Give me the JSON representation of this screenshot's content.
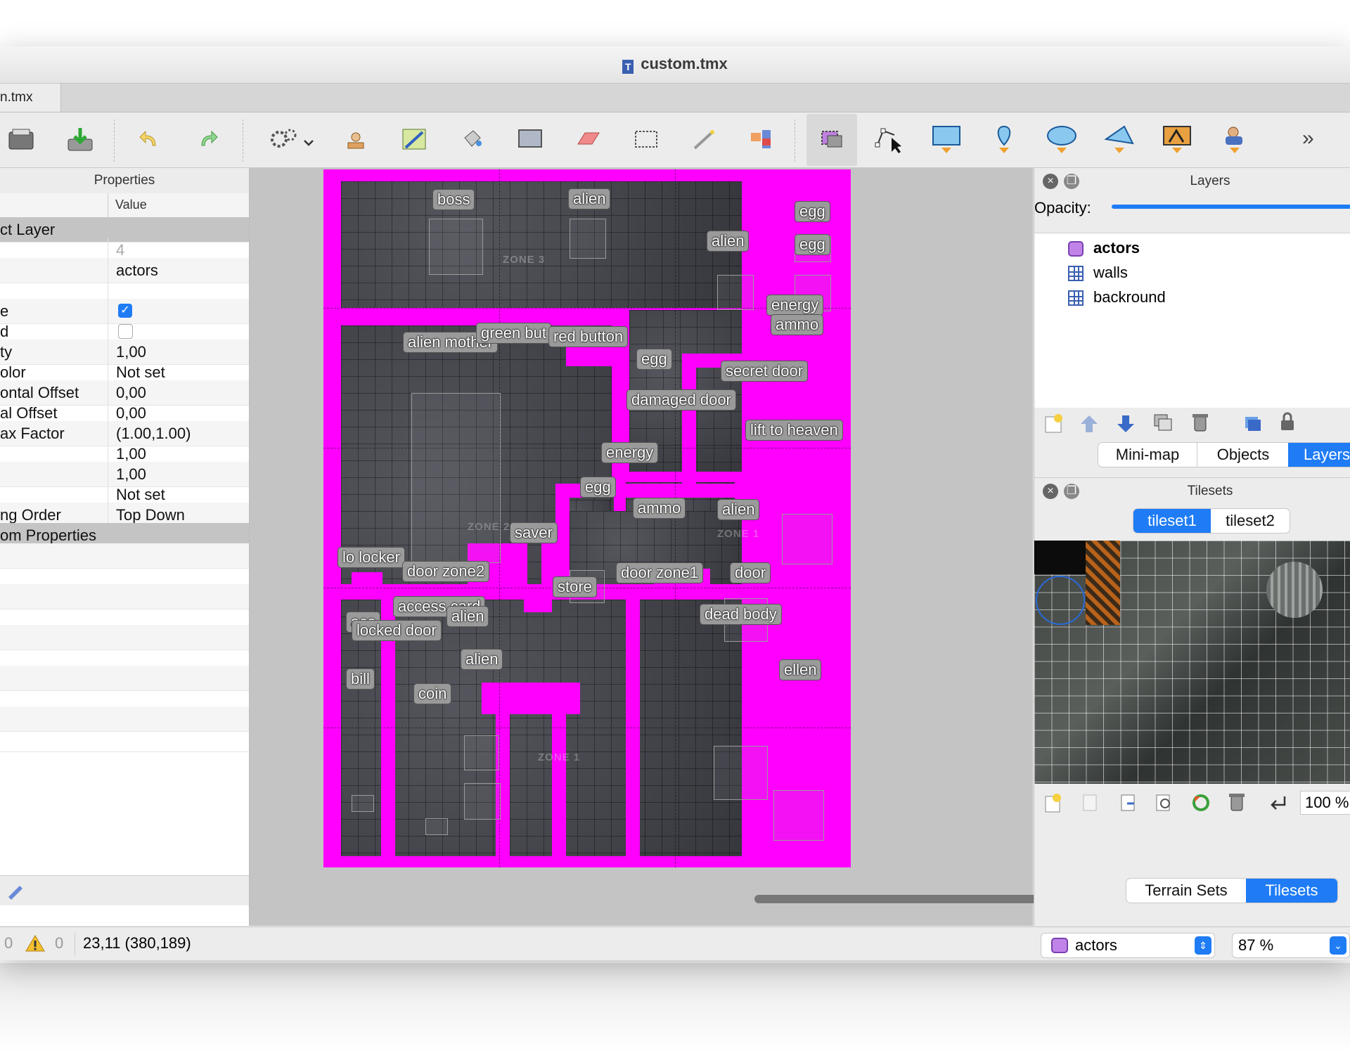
{
  "window": {
    "title": "custom.tmx",
    "tab_label": "n.tmx"
  },
  "toolbar": {
    "more_label": "»"
  },
  "properties": {
    "title": "Properties",
    "col_value": "Value",
    "rows": [
      {
        "key": "ct Layer",
        "value": "",
        "type": "section"
      },
      {
        "key": "",
        "value": "4",
        "type": "muted"
      },
      {
        "key": "",
        "value": "actors",
        "type": "text"
      },
      {
        "key": "",
        "value": "",
        "type": "text"
      },
      {
        "key": "e",
        "value": "",
        "type": "check-on"
      },
      {
        "key": "d",
        "value": "",
        "type": "check-off"
      },
      {
        "key": "ty",
        "value": "1,00",
        "type": "text"
      },
      {
        "key": "olor",
        "value": "Not set",
        "type": "text"
      },
      {
        "key": "ontal Offset",
        "value": "0,00",
        "type": "text"
      },
      {
        "key": "al Offset",
        "value": "0,00",
        "type": "text"
      },
      {
        "key": "ax Factor",
        "value": "(1.00,1.00)",
        "type": "text"
      },
      {
        "key": "",
        "value": "1,00",
        "type": "text"
      },
      {
        "key": "",
        "value": "1,00",
        "type": "text"
      },
      {
        "key": "",
        "value": "Not set",
        "type": "text"
      },
      {
        "key": "ng Order",
        "value": "Top Down",
        "type": "text"
      },
      {
        "key": "om Properties",
        "value": "",
        "type": "section"
      }
    ]
  },
  "map": {
    "zones": [
      "ZONE 3",
      "ZONE 2",
      "ZONE 1",
      "ZONE 1"
    ],
    "labels": [
      "boss",
      "alien",
      "egg",
      "alien",
      "egg",
      "energy",
      "ammo",
      "alien mother",
      "green but",
      "red button",
      "egg",
      "secret door",
      "damaged door",
      "lift to heaven",
      "energy",
      "egg",
      "ammo",
      "alien",
      "saver",
      "lo locker",
      "door zone2",
      "door zone1",
      "door",
      "store",
      "access card",
      "alien",
      "ace",
      "locked door",
      "alien",
      "dead body",
      "bill",
      "coin",
      "ellen"
    ]
  },
  "layers_panel": {
    "title": "Layers",
    "opacity_label": "Opacity:",
    "opacity": 1.0,
    "items": [
      {
        "name": "actors",
        "icon": "object-layer-icon",
        "selected": true
      },
      {
        "name": "walls",
        "icon": "tile-layer-icon",
        "selected": false
      },
      {
        "name": "backround",
        "icon": "tile-layer-icon",
        "selected": false
      }
    ],
    "tabs": [
      "Mini-map",
      "Objects",
      "Layers"
    ]
  },
  "tilesets_panel": {
    "title": "Tilesets",
    "tabs": [
      "tileset1",
      "tileset2"
    ],
    "zoom": "100 %",
    "bottom_tabs": [
      "Terrain Sets",
      "Tilesets"
    ]
  },
  "status": {
    "errors": "0",
    "warnings": "0",
    "coords": "23,11 (380,189)",
    "layer": "actors",
    "zoom": "87 %"
  }
}
